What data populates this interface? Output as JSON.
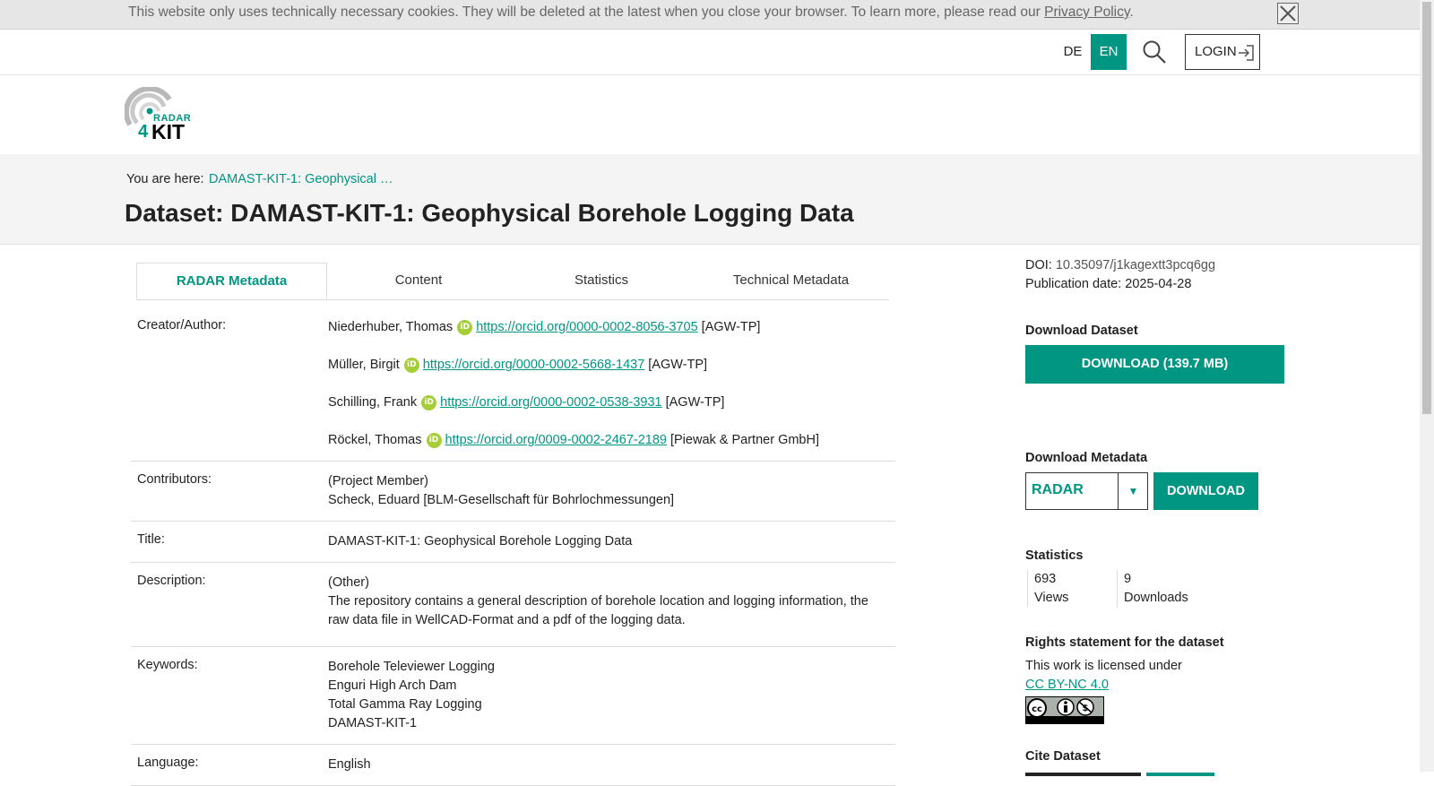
{
  "cookie": {
    "text": "This website only uses technically necessary cookies. They will be deleted at the latest when you close your browser. To learn more, please read our ",
    "link": "Privacy Policy",
    "suffix": "."
  },
  "nav": {
    "lang_de": "DE",
    "lang_en": "EN",
    "login": "LOGIN"
  },
  "logo": {
    "line1": "RADAR",
    "line2": "4",
    "line3": "KIT"
  },
  "breadcrumb": {
    "label": "You are here:",
    "current": "DAMAST-KIT-1: Geophysical …"
  },
  "title": "Dataset: DAMAST-KIT-1: Geophysical Borehole Logging Data",
  "tabs": [
    "RADAR Metadata",
    "Content",
    "Statistics",
    "Technical Metadata"
  ],
  "metadata": {
    "creator_label": "Creator/Author:",
    "authors": [
      {
        "name": "Niederhuber, Thomas",
        "orcid": "https://orcid.org/0000-0002-8056-3705",
        "affil": "[AGW-TP]"
      },
      {
        "name": "Müller, Birgit",
        "orcid": "https://orcid.org/0000-0002-5668-1437",
        "affil": "[AGW-TP]"
      },
      {
        "name": "Schilling, Frank",
        "orcid": "https://orcid.org/0000-0002-0538-3931",
        "affil": "[AGW-TP]"
      },
      {
        "name": "Röckel, Thomas",
        "orcid": "https://orcid.org/0009-0002-2467-2189",
        "affil": "[Piewak & Partner GmbH]"
      }
    ],
    "contributors_label": "Contributors:",
    "contributors_role": "(Project Member)",
    "contributors_name": "Scheck, Eduard [BLM-Gesellschaft für Bohrlochmessungen]",
    "title_label": "Title:",
    "title_value": "DAMAST-KIT-1: Geophysical Borehole Logging Data",
    "description_label": "Description:",
    "description_type": "(Other)",
    "description_text": "The repository contains a general description of borehole location and logging information, the raw data file in WellCAD-Format and a pdf of the logging data.",
    "keywords_label": "Keywords:",
    "keywords": [
      "Borehole Televiewer Logging",
      "Enguri High Arch Dam",
      "Total Gamma Ray Logging",
      "DAMAST-KIT-1"
    ],
    "language_label": "Language:",
    "language_value": "English"
  },
  "sidebar": {
    "doi_label": "DOI:",
    "doi_value": "10.35097/j1kagextt3pcq6gg",
    "pub_label": "Publication date:",
    "pub_value": "2025-04-28",
    "download_dataset_heading": "Download Dataset",
    "download_dataset_button": "DOWNLOAD (139.7 MB)",
    "download_metadata_heading": "Download Metadata",
    "metadata_format": "RADAR",
    "download_metadata_button": "DOWNLOAD",
    "statistics_heading": "Statistics",
    "views_count": "693",
    "views_label": "Views",
    "downloads_count": "9",
    "downloads_label": "Downloads",
    "rights_heading": "Rights statement for the dataset",
    "rights_text": "This work is licensed under",
    "license_link": "CC BY-NC 4.0",
    "cite_heading": "Cite Dataset"
  },
  "colors": {
    "accent": "#009682",
    "orcid": "#a6ce39"
  }
}
